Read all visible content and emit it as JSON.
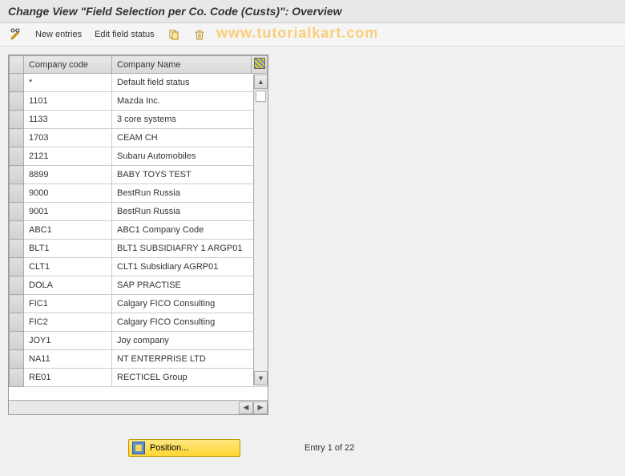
{
  "header": {
    "title": "Change View \"Field Selection per Co. Code (Custs)\": Overview"
  },
  "toolbar": {
    "new_entries": "New entries",
    "edit_field_status": "Edit field status"
  },
  "watermark": "www.tutorialkart.com",
  "table": {
    "columns": {
      "code": "Company code",
      "name": "Company Name"
    },
    "rows": [
      {
        "code": "*",
        "name": "Default field status"
      },
      {
        "code": "1101",
        "name": "Mazda Inc."
      },
      {
        "code": "1133",
        "name": "3 core systems"
      },
      {
        "code": "1703",
        "name": "CEAM CH"
      },
      {
        "code": "2121",
        "name": "Subaru Automobiles"
      },
      {
        "code": "8899",
        "name": "BABY TOYS TEST"
      },
      {
        "code": "9000",
        "name": "BestRun Russia"
      },
      {
        "code": "9001",
        "name": "BestRun Russia"
      },
      {
        "code": "ABC1",
        "name": "ABC1 Company Code"
      },
      {
        "code": "BLT1",
        "name": "BLT1 SUBSIDIAFRY 1 ARGP01"
      },
      {
        "code": "CLT1",
        "name": "CLT1 Subsidiary AGRP01"
      },
      {
        "code": "DOLA",
        "name": "SAP PRACTISE"
      },
      {
        "code": "FIC1",
        "name": "Calgary FICO Consulting"
      },
      {
        "code": "FIC2",
        "name": "Calgary FICO Consulting"
      },
      {
        "code": "JOY1",
        "name": "Joy company"
      },
      {
        "code": "NA11",
        "name": "NT ENTERPRISE LTD"
      },
      {
        "code": "RE01",
        "name": "RECTICEL Group"
      }
    ]
  },
  "footer": {
    "position_label": "Position...",
    "entry_text": "Entry 1 of 22"
  }
}
